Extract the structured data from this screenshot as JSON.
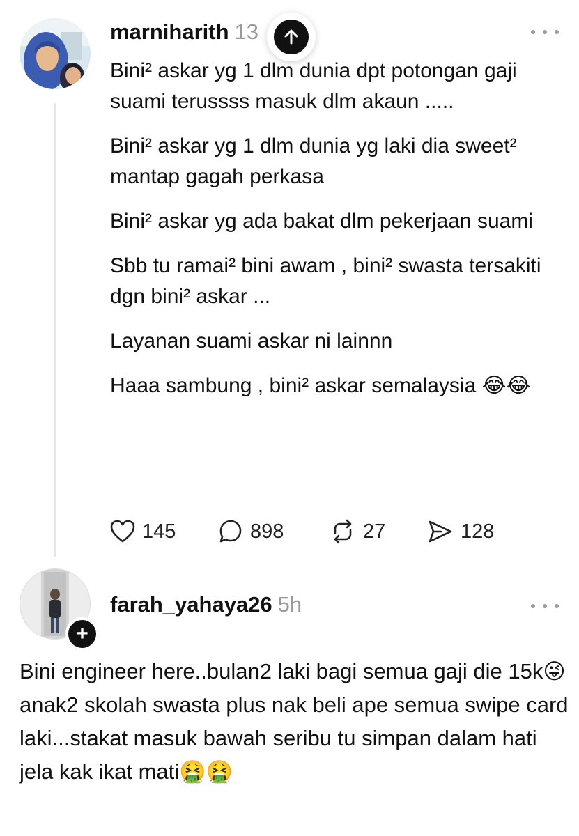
{
  "post1": {
    "username": "marniharith",
    "time": "13",
    "paragraphs": [
      "Bini² askar yg 1 dlm dunia dpt potongan gaji suami terussss masuk dlm akaun .....",
      "Bini² askar yg 1 dlm dunia yg laki dia sweet² mantap gagah perkasa",
      "Bini² askar yg ada bakat dlm pekerjaan suami",
      "Sbb tu ramai² bini awam , bini² swasta tersakiti dgn bini² askar ...",
      "Layanan suami askar ni lainnn"
    ],
    "last_paragraph_text": "Haaa sambung , bini² askar semalaysia",
    "last_paragraph_emoji": "😂😂",
    "likes": "145",
    "replies": "898",
    "reposts": "27",
    "shares": "128"
  },
  "post2": {
    "username": "farah_yahaya26",
    "time": "5h",
    "text_part1": "Bini engineer here..bulan2 laki bagi semua gaji die 15k",
    "emoji1": "😜",
    "text_part2": "anak2 skolah swasta plus nak beli ape semua swipe card laki...stakat masuk bawah seribu tu simpan dalam hati jela kak ikat mati",
    "emoji2": "🤮🤮"
  },
  "icons": {
    "scroll_up": "arrow-up-icon",
    "more": "more-horizontal-icon",
    "like": "heart-icon",
    "reply": "comment-icon",
    "repost": "repost-icon",
    "share": "send-icon",
    "follow": "plus-icon"
  },
  "colors": {
    "text": "#111111",
    "muted": "#9a9a9a",
    "thread_line": "#e6e6e6",
    "background": "#ffffff"
  }
}
